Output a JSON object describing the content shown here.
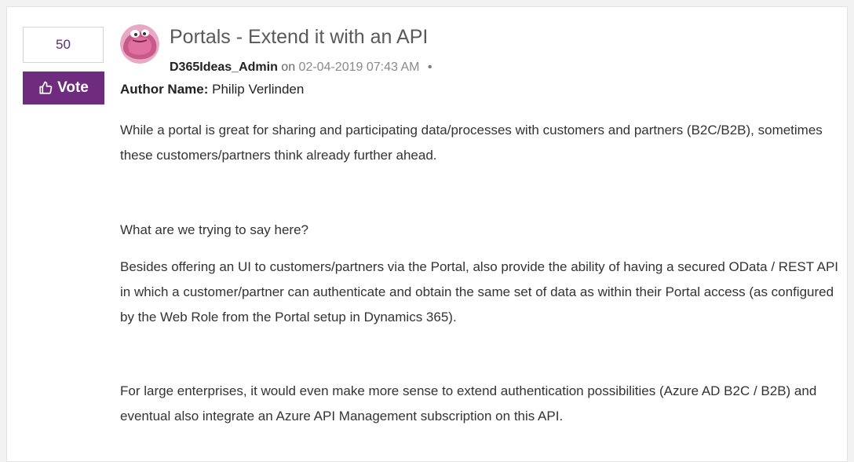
{
  "post": {
    "kudos_count": "50",
    "vote_label": "Vote",
    "title": "Portals - Extend it with an API",
    "author": "D365Ideas_Admin",
    "on_text": "on",
    "date": "02-04-2019 07:43 AM",
    "bullet": "•",
    "author_name_label": "Author Name:",
    "author_name_value": "Philip Verlinden",
    "paragraphs": [
      "While a portal is great for sharing and participating data/processes with customers and partners (B2C/B2B), sometimes these customers/partners think already further ahead.",
      "What are we trying to say here?",
      "Besides offering an UI to customers/partners via the Portal, also provide the ability of having a secured OData / REST API in which a customer/partner can authenticate and obtain the same set of data as within their Portal access (as configured by the Web Role from the Portal setup in Dynamics 365).",
      "For large enterprises, it would even make more sense to extend authentication possibilities (Azure AD B2C / B2B) and eventual also integrate an Azure API Management subscription on this API."
    ]
  },
  "colors": {
    "vote_bg": "#6f2b7e",
    "avatar_pink": "#e0709f"
  },
  "icons": {
    "vote": "thumbs-up-icon",
    "avatar": "pink-creature-avatar"
  }
}
